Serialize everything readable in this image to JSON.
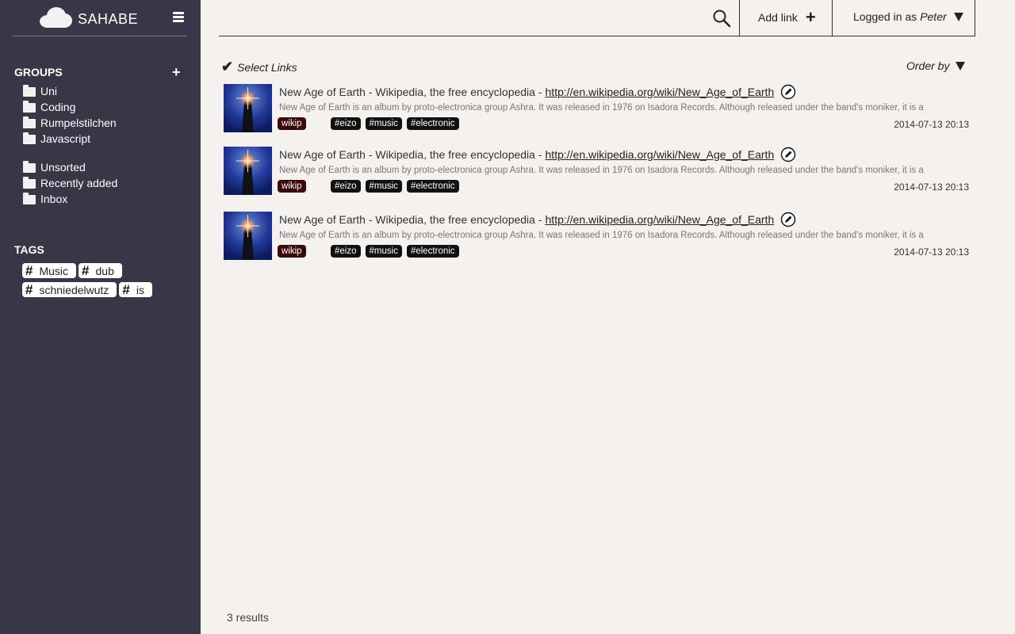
{
  "app": {
    "name": "SAHABE"
  },
  "sidebar": {
    "groups_title": "GROUPS",
    "groups": [
      {
        "label": "Uni"
      },
      {
        "label": "Coding"
      },
      {
        "label": "Rumpelstilchen"
      },
      {
        "label": "Javascript"
      }
    ],
    "special_groups": [
      {
        "label": "Unsorted"
      },
      {
        "label": "Recently added"
      },
      {
        "label": "Inbox"
      }
    ],
    "tags_title": "TAGS",
    "tags": [
      {
        "label": "Music"
      },
      {
        "label": "dub"
      },
      {
        "label": "schniedelwutz"
      },
      {
        "label": "is"
      }
    ]
  },
  "header": {
    "add_link_label": "Add link",
    "login_prefix": "Logged in as",
    "user": "Peter"
  },
  "toolbar": {
    "select_links_label": "Select Links",
    "order_by_label": "Order by"
  },
  "links": [
    {
      "title": "New Age of Earth - Wikipedia, the free encyclopedia -",
      "url": "http://en.wikipedia.org/wiki/New_Age_of_Earth",
      "description": "New Age of Earth is an album by proto-electronica group Ashra. It was released in 1976 on Isadora Records. Although released under the band's moniker, it is a",
      "group": "wikip",
      "tags": [
        "#eizo",
        "#music",
        "#electronic"
      ],
      "date": "2014-07-13 20:13"
    },
    {
      "title": "New Age of Earth - Wikipedia, the free encyclopedia -",
      "url": "http://en.wikipedia.org/wiki/New_Age_of_Earth",
      "description": "New Age of Earth is an album by proto-electronica group Ashra. It was released in 1976 on Isadora Records. Although released under the band's moniker, it is a",
      "group": "wikip",
      "tags": [
        "#eizo",
        "#music",
        "#electronic"
      ],
      "date": "2014-07-13 20:13"
    },
    {
      "title": "New Age of Earth - Wikipedia, the free encyclopedia -",
      "url": "http://en.wikipedia.org/wiki/New_Age_of_Earth",
      "description": "New Age of Earth is an album by proto-electronica group Ashra. It was released in 1976 on Isadora Records. Although released under the band's moniker, it is a",
      "group": "wikip",
      "tags": [
        "#eizo",
        "#music",
        "#electronic"
      ],
      "date": "2014-07-13 20:13"
    }
  ],
  "footer": {
    "results_text": "3 results"
  },
  "colors": {
    "sidebar_bg": "#373747",
    "content_bg": "#f4f1ee",
    "group_badge": "#3a0a0a",
    "hashtag_badge": "#111111"
  },
  "icons": {
    "logo": "cloud-icon",
    "menu": "hamburger-icon",
    "add_group": "plus-icon",
    "folder": "folder-icon",
    "tag": "hash-icon",
    "search": "search-icon",
    "add_link": "plus-icon",
    "user_menu": "caret-down-icon",
    "select": "check-icon",
    "order": "caret-down-icon",
    "edit": "pencil-icon"
  }
}
